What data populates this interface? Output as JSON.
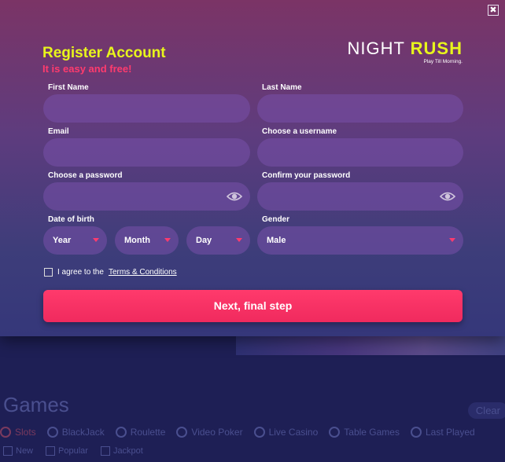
{
  "modal": {
    "title": "Register Account",
    "subtitle": "It is easy and free!",
    "close_label": "✖",
    "logo": {
      "night": "NIGHT",
      "rush": "RUSH",
      "tagline": "Play Till Morning."
    }
  },
  "form": {
    "first_name": {
      "label": "First Name",
      "value": ""
    },
    "last_name": {
      "label": "Last Name",
      "value": ""
    },
    "email": {
      "label": "Email",
      "value": ""
    },
    "username": {
      "label": "Choose a username",
      "value": ""
    },
    "password": {
      "label": "Choose a password",
      "value": ""
    },
    "confirm_password": {
      "label": "Confirm your password",
      "value": ""
    },
    "dob": {
      "label": "Date of birth",
      "year": "Year",
      "month": "Month",
      "day": "Day"
    },
    "gender": {
      "label": "Gender",
      "value": "Male"
    },
    "agree_text": "I agree to the",
    "terms_link": "Terms & Conditions",
    "submit_label": "Next, final step"
  },
  "background": {
    "games_title": "Games",
    "clear_label": "Clear",
    "tabs": [
      "Slots",
      "BlackJack",
      "Roulette",
      "Video Poker",
      "Live Casino",
      "Table Games",
      "Last Played"
    ],
    "filters": [
      "New",
      "Popular",
      "Jackpot"
    ]
  },
  "colors": {
    "accent_yellow": "#e8f51c",
    "accent_pink": "#ff3b6e",
    "button": "#f02a5e"
  }
}
